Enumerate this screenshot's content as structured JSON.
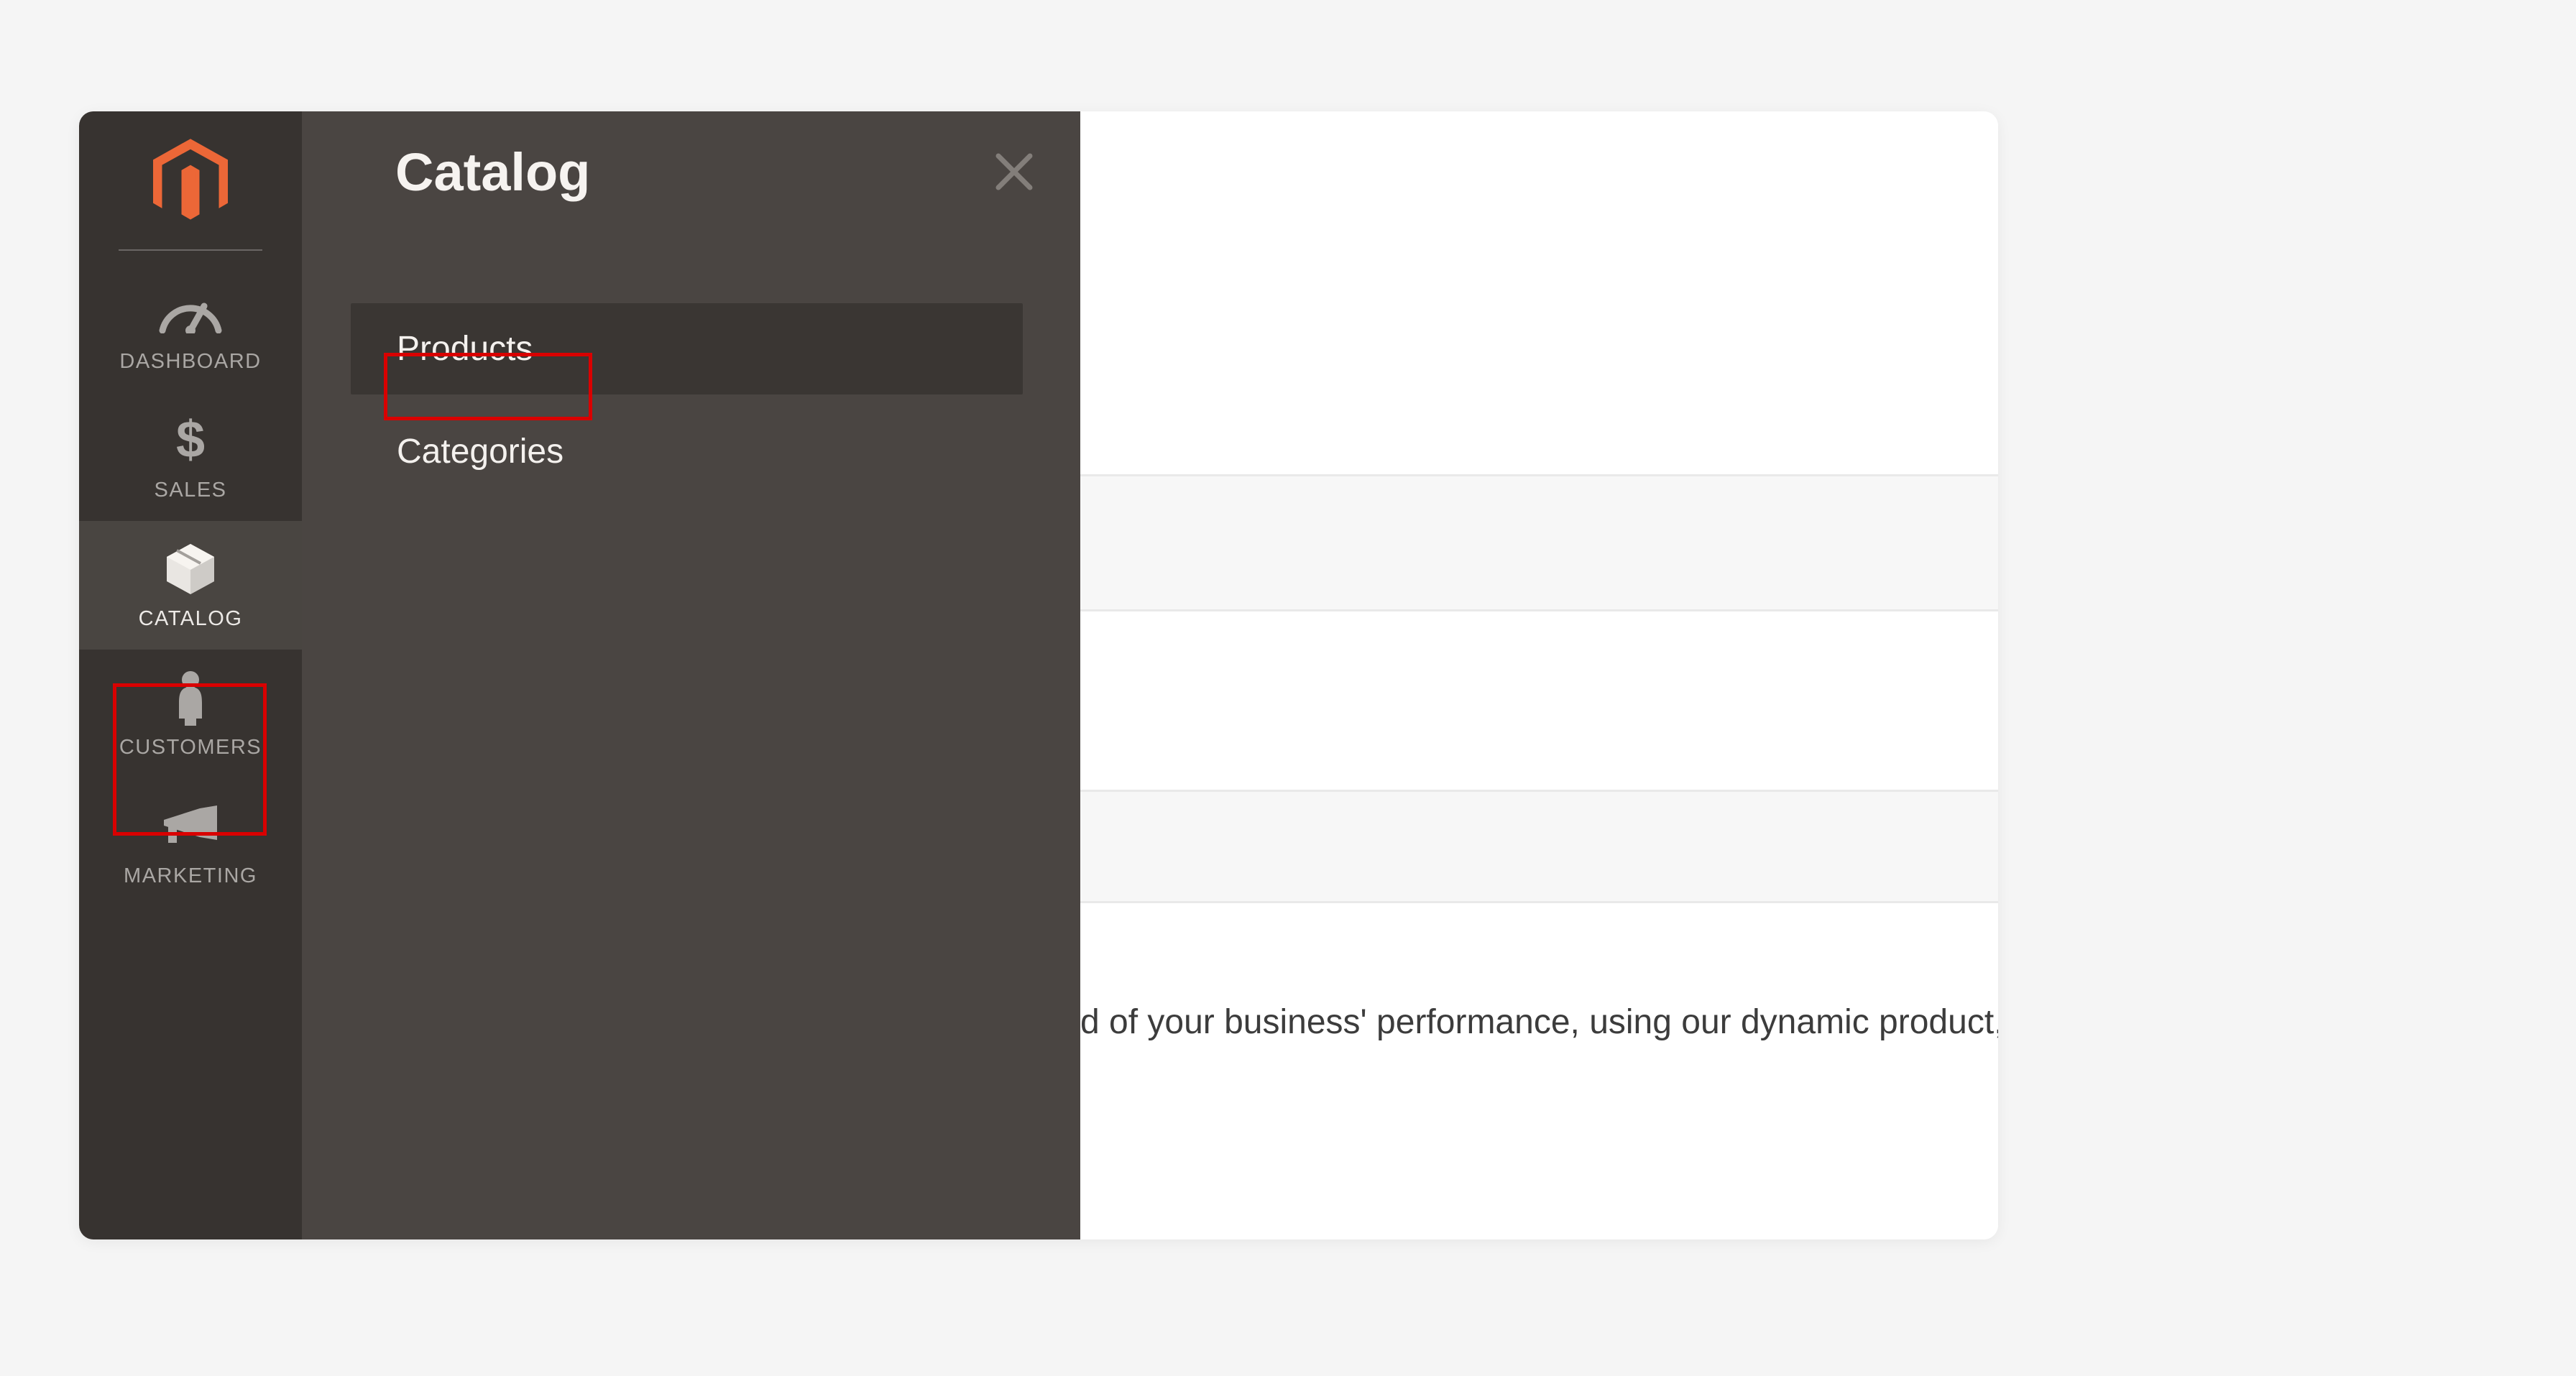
{
  "sidebar": {
    "items": [
      {
        "label": "DASHBOARD"
      },
      {
        "label": "SALES"
      },
      {
        "label": "CATALOG"
      },
      {
        "label": "CUSTOMERS"
      },
      {
        "label": "MARKETING"
      }
    ]
  },
  "flyout": {
    "title": "Catalog",
    "items": [
      {
        "label": "Products"
      },
      {
        "label": "Categories"
      }
    ]
  },
  "main": {
    "snippet": "d of your business' performance, using our dynamic product, or"
  }
}
